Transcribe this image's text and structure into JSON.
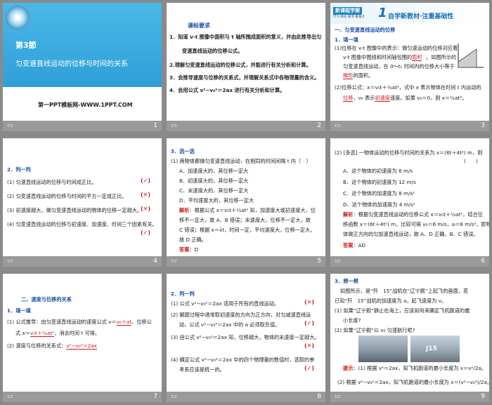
{
  "s1": {
    "chapter": "第3節",
    "title": "匀变速直线运动的位移与时间的关系",
    "site": "第一PPT模板网-WWW.1PPT.COM",
    "page": "1"
  },
  "s2": {
    "heading": "课标要求",
    "lines": [
      "1．知道 v-t 图像中面积与 t 轴所围成面积的意义，并由此推导出匀",
      "变速直线运动的位移公式。",
      "2.理解匀变速直线运动的位移公式，并能进行有关分析和计算。",
      "3．会推导速度与位移的关系式，并理解关系式中各物理量的含义。",
      "4．会用公式 v²−v₀²＝2ax 进行有关分析和计算。"
    ],
    "page": "2"
  },
  "s3": {
    "banner": "新课程学案",
    "banner_sub": "学习·目标·要求·重难点",
    "num": "1",
    "title": "自学新教材·注重基础性",
    "sec": "一、匀变速直线运动的位移",
    "task": "1．填一填",
    "lines": [
      "(1)位移在 v-t 图像中的表示：做匀速运动的位移对应着",
      "v-t 图像中图线和时间轴包围的",
      "。如图所示的",
      "匀变速直线运动，在 0～t₁ 时间内的位移大小等于",
      "的面积。",
      "(2)位移公式：x＝v₀t＋½at²，式中 x 表示物体在时间 t 内运动的",
      "，v₀ 表示",
      "速度。如果 v₀＝0，则 x＝½at²。"
    ],
    "blanks": [
      "面积",
      "梯形",
      "位移",
      "初速度"
    ],
    "page": "3"
  },
  "s4": {
    "heading": "2．判一判",
    "items": [
      "(1) 匀速直线运动的位移与时间成正比。",
      "(2) 匀变速直线运动的位移与时间的平方一定成正比。",
      "(3) 初速度越大，做匀变速直线运动的物体的位移一定越大。",
      "(4) 匀变速直线运动的位移与初速度、加速度、时间三个因素有关。"
    ],
    "marks": [
      "(✓)",
      "(✕)",
      "(✕)",
      "(✓)"
    ],
    "page": "4"
  },
  "s5": {
    "heading": "3．选一选",
    "q": "(1) 两物体都做匀变速直线运动，在相同的时间间隔 t 内（　）",
    "opts": [
      "A．加速度大的，其位移一定大",
      "B．初速度大的，其位移一定大",
      "C．末速度大的，其位移一定大",
      "D．平均速度大的，其位移一定大"
    ],
    "jx_label": "解析",
    "jx": [
      "：根据公式 x＝v₀t＋½at² 知，加速度大或初速度大，位",
      "移不一定大，故 A、B 错误；末速度大，位移不一定大，故",
      "C 错误；根据 x＝v̄t，时间一定，平均速度大，位移一定大，",
      "故 D 正确。"
    ],
    "ans_label": "答案",
    "ans": "：D",
    "page": "5"
  },
  "s6": {
    "q": "(2) [多选] 一物体运动的位移与时间的关系为 x＝(6t＋4t²) m，则",
    "paren": "(　　)",
    "opts": [
      "A．这个物体的初速度为 6 m/s",
      "B．这个物体的初速度为 12 m/s",
      "C．这个物体的加速度为 8 m/s²",
      "D．这个物体的加速度为 4 m/s²"
    ],
    "jx_label": "解析",
    "jx": [
      "：根据匀变速直线运动的位移公式 x＝v₀t＋½at²，结合位",
      "移函数 x＝(6t＋4t²) m，比较可得 v₀＝6 m/s，a＝8 m/s²，即物",
      "体做正方向的匀加速直线运动，故 A、D 正确，B、C 错误。"
    ],
    "ans_label": "答案",
    "ans": "：AD",
    "page": "6"
  },
  "s7": {
    "sec": "二、速度与位移的关系",
    "task": "1．填一填",
    "l1": "(1) 公式推导：由匀变速直线运动的速度公式 v＝",
    "l1b": "v₀＋at",
    "l1c": "、位移公",
    "l2": "式 x＝",
    "l2b": "v₀t＋½at²",
    "l2c": "，消去时间 t 可得。",
    "l3": "(2) 速度与位移的关系式：",
    "l3b": "v²−v₀²＝2ax",
    "page": "7"
  },
  "s8": {
    "heading": "2．判一判",
    "items": [
      "(1) 公式 v²−v₀²＝2ax 适用于所有的直线运动。",
      "(2) 解题过程中通常取初速度的方向为正方向，对匀减速直线运",
      "动，公式 v²−v₀²＝2ax 中的 a 必须取负值。",
      "(3) 由公式 v²−v₀²＝2ax 知，位移越大，物体的末速度一定越大。",
      "(4) 确定公式 v²−v₀²＝2ax 中的四个物理量的数值时，选取的参",
      "考系应该是统一的。"
    ],
    "marks": [
      "(✕)",
      "(✓)",
      "(✕)",
      "(✓)"
    ],
    "page": "8"
  },
  "s9": {
    "heading": "3．想一想",
    "lines": [
      "如图所示，是“歼　15”战机在“辽宁舰”上起飞的画面，若",
      "已知“歼　15”战机的加速度为 a，起飞速度为 v。",
      "(1) 如果“辽宁舰”静止在海上，应该如何来确定飞机跑道的最",
      "小长度?",
      "(2) 如果“辽宁舰”以 v₀ 匀速航行呢?"
    ],
    "tip_label": "提示",
    "tip1": "：(1) 根据 v²＝2ax，知飞机跑道的最小长度为 x＝v²/2a。",
    "tip2": "(2) 根据 v²−v₀²＝2ax，知飞机跑道的最小长度为 x＝(v²−v₀²)/2a。",
    "img_text": "J15",
    "page": "9"
  }
}
